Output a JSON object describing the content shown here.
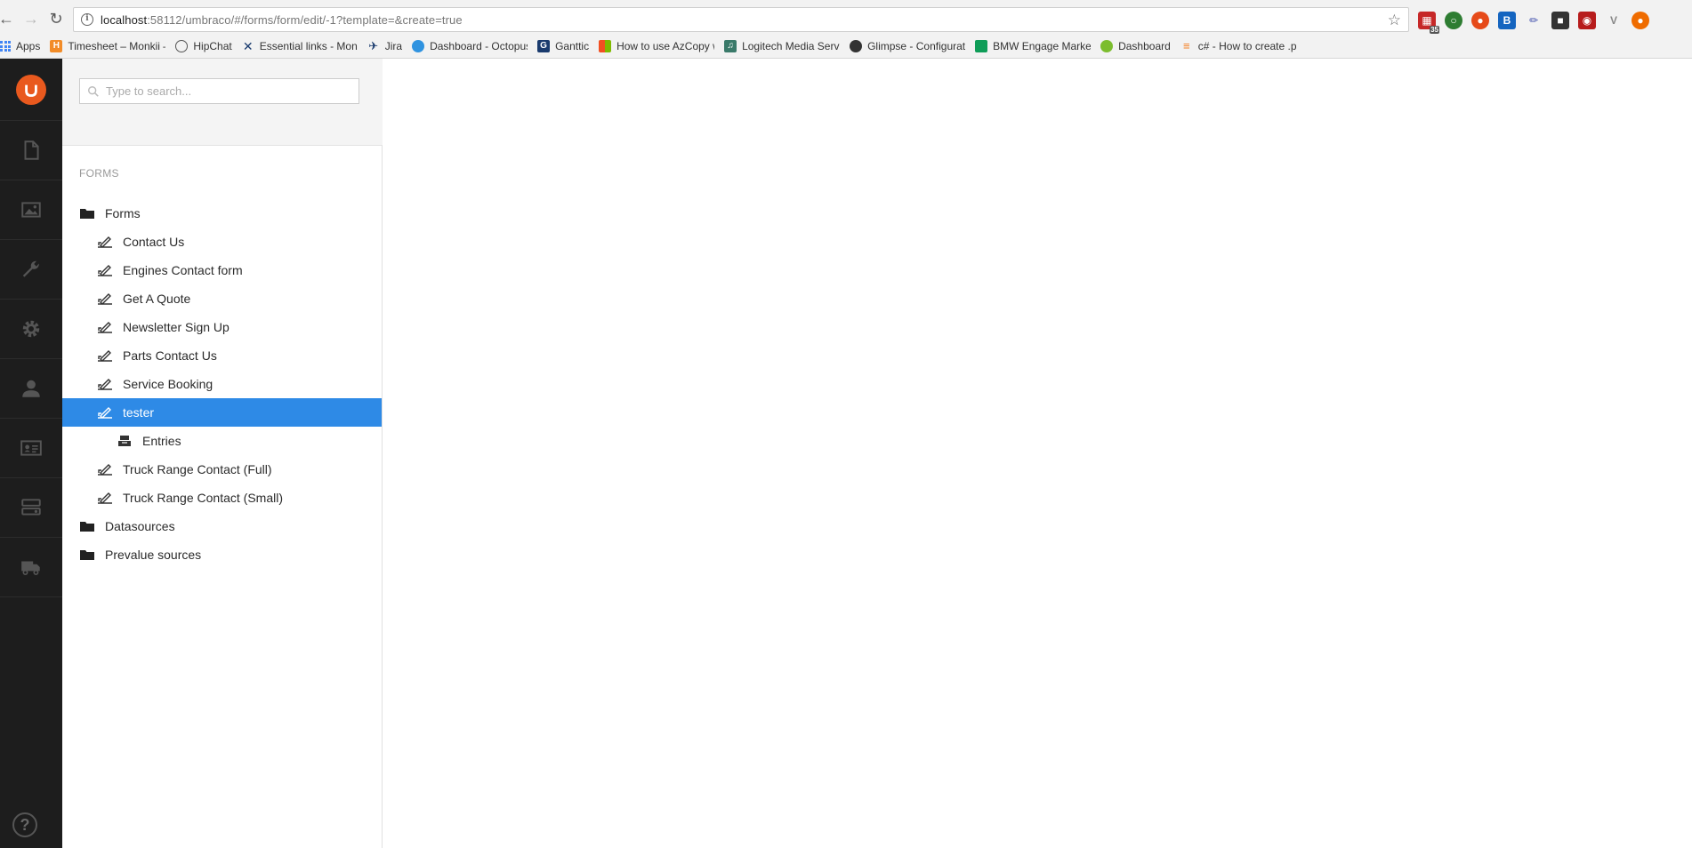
{
  "browser": {
    "url": "localhost:58112/umbraco/#/forms/form/edit/-1?template=&create=true",
    "url_host": "localhost",
    "url_rest": ":58112/umbraco/#/forms/form/edit/-1?template=&create=true",
    "ext_badge": "35",
    "bookmarks": [
      {
        "label": "Apps",
        "color": "#4285f4"
      },
      {
        "label": "Timesheet – Monkii –",
        "color": "#f28c28",
        "glyph": "H"
      },
      {
        "label": "HipChat",
        "color": "#ffffff",
        "glyph": "○"
      },
      {
        "label": "Essential links - Monk",
        "color": "#ffffff",
        "glyph": "✕"
      },
      {
        "label": "Jira",
        "color": "#ffffff",
        "glyph": "✈"
      },
      {
        "label": "Dashboard - Octopus",
        "color": "#2f93e0",
        "glyph": "●"
      },
      {
        "label": "Ganttic",
        "color": "#1a3b6e",
        "glyph": "G"
      },
      {
        "label": "How to use AzCopy w",
        "color": "#f25022",
        "glyph": "■"
      },
      {
        "label": "Logitech Media Serve",
        "color": "#3a7a6a",
        "glyph": "♫"
      },
      {
        "label": "Glimpse - Configurati",
        "color": "#333333",
        "glyph": "◐"
      },
      {
        "label": "BMW Engage Market",
        "color": "#0f9d58",
        "glyph": "▦"
      },
      {
        "label": "Dashboard",
        "color": "#7cbd2e",
        "glyph": "●"
      },
      {
        "label": "c# - How to create .pf",
        "color": "#f48024",
        "glyph": "≡"
      }
    ]
  },
  "sections": [
    "content-icon",
    "media-icon",
    "settings-wrench-icon",
    "developer-gear-icon",
    "users-icon",
    "members-icon",
    "forms-icon",
    "delivery-truck-icon"
  ],
  "tree": {
    "search_placeholder": "Type to search...",
    "header": "FORMS",
    "nodes": [
      {
        "label": "Forms",
        "type": "folder",
        "level": 0
      },
      {
        "label": "Contact Us",
        "type": "form",
        "level": 1
      },
      {
        "label": "Engines Contact form",
        "type": "form",
        "level": 1
      },
      {
        "label": "Get A Quote",
        "type": "form",
        "level": 1
      },
      {
        "label": "Newsletter Sign Up",
        "type": "form",
        "level": 1
      },
      {
        "label": "Parts Contact Us",
        "type": "form",
        "level": 1
      },
      {
        "label": "Service Booking",
        "type": "form",
        "level": 1
      },
      {
        "label": "tester",
        "type": "form",
        "level": 1,
        "selected": true
      },
      {
        "label": "Entries",
        "type": "entries",
        "level": 2
      },
      {
        "label": "Truck Range Contact (Full)",
        "type": "form",
        "level": 1
      },
      {
        "label": "Truck Range Contact (Small)",
        "type": "form",
        "level": 1
      },
      {
        "label": "Datasources",
        "type": "folder",
        "level": 0
      },
      {
        "label": "Prevalue sources",
        "type": "folder",
        "level": 0
      }
    ]
  },
  "colors": {
    "selected": "#2e8ae6",
    "section_bar": "#1d1d1d",
    "logo": "#e9591e"
  }
}
